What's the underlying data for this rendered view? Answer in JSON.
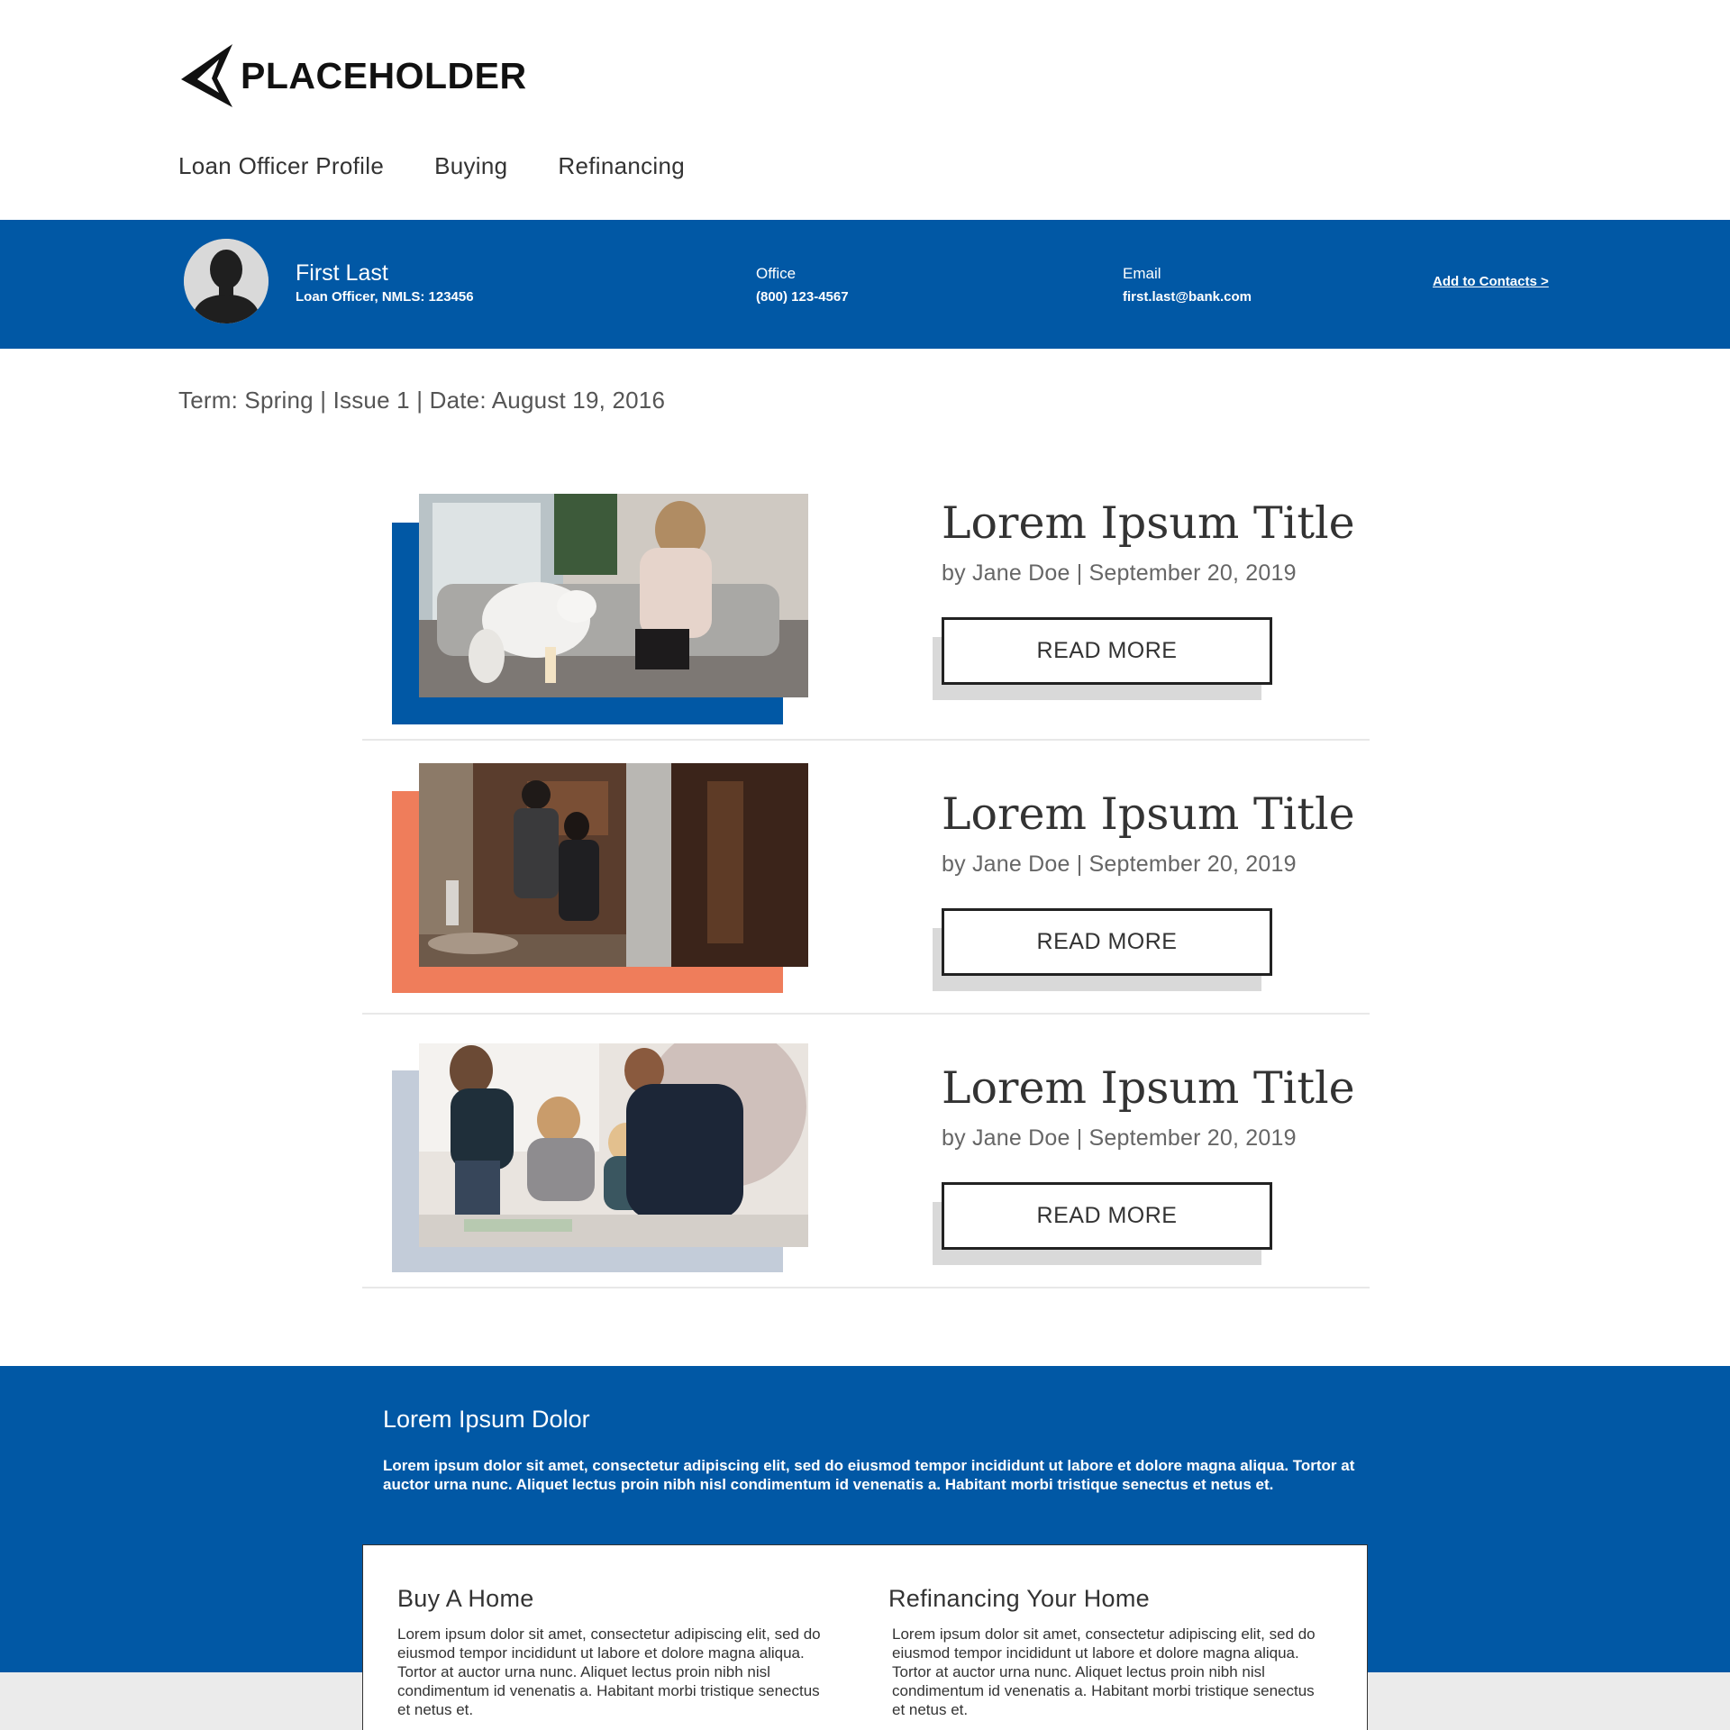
{
  "header": {
    "logo_text": "PLACEHOLDER",
    "nav": [
      "Loan Officer Profile",
      "Buying",
      "Refinancing"
    ]
  },
  "profile": {
    "name": "First Last",
    "role": "Loan Officer, NMLS: 123456",
    "office_label": "Office",
    "office_value": "(800) 123-4567",
    "email_label": "Email",
    "email_value": "first.last@bank.com",
    "add_contacts": "Add to Contacts >"
  },
  "term_line": "Term: Spring | Issue 1 | Date: August 19, 2016",
  "articles": [
    {
      "title": "Lorem Ipsum Title",
      "meta": "by Jane Doe | September 20, 2019",
      "button": "READ MORE",
      "accent": "#0158a5"
    },
    {
      "title": "Lorem Ipsum Title",
      "meta": "by Jane Doe | September 20, 2019",
      "button": "READ MORE",
      "accent": "#ef7d5b"
    },
    {
      "title": "Lorem Ipsum Title",
      "meta": "by  Jane Doe | September 20, 2019",
      "button": "READ MORE",
      "accent": "#c3ccd9"
    }
  ],
  "footer": {
    "title": "Lorem Ipsum Dolor",
    "text": "Lorem ipsum dolor sit amet, consectetur adipiscing elit, sed do eiusmod tempor incididunt ut labore et dolore magna aliqua. Tortor at auctor urna nunc. Aliquet lectus proin nibh nisl condimentum id venenatis a. Habitant morbi tristique senectus et netus et.",
    "cards": [
      {
        "title": "Buy A Home",
        "text": "Lorem ipsum dolor sit amet, consectetur adipiscing elit, sed do eiusmod tempor incididunt ut labore et dolore magna aliqua. Tortor at auctor urna nunc. Aliquet lectus proin nibh nisl condimentum id venenatis a. Habitant morbi tristique senectus et netus et."
      },
      {
        "title": "Refinancing Your Home",
        "text": "Lorem ipsum dolor sit amet, consectetur adipiscing elit, sed do eiusmod tempor incididunt ut labore et dolore magna aliqua. Tortor at auctor urna nunc. Aliquet lectus proin nibh nisl condimentum id venenatis a. Habitant morbi tristique senectus et netus et."
      }
    ]
  },
  "colors": {
    "brand_blue": "#0158a5",
    "accent_orange": "#ef7d5b",
    "accent_gray_blue": "#c3ccd9"
  }
}
